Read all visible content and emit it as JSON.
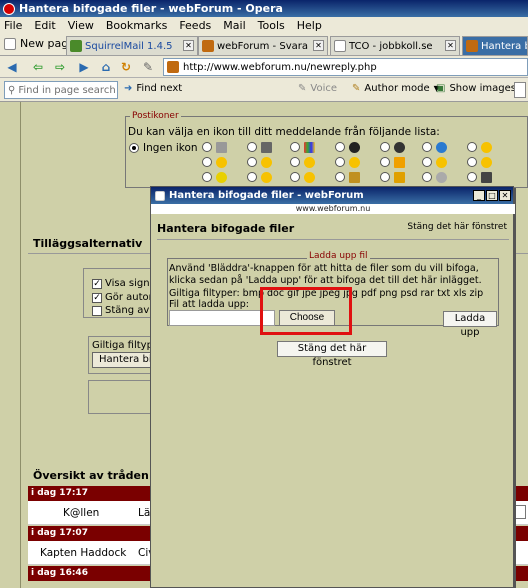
{
  "window": {
    "title": "Hantera bifogade filer - webForum - Opera"
  },
  "menu": [
    "File",
    "Edit",
    "View",
    "Bookmarks",
    "Feeds",
    "Mail",
    "Tools",
    "Help"
  ],
  "tabs": {
    "new_page": "New page",
    "items": [
      {
        "label": "SquirrelMail 1.4.5",
        "active": false
      },
      {
        "label": "webForum - Svara",
        "active": false
      },
      {
        "label": "TCO - jobbkoll.se",
        "active": false
      },
      {
        "label": "Hantera bifo",
        "active": true
      }
    ]
  },
  "address": {
    "url": "http://www.webforum.nu/newreply.php"
  },
  "searchbar": {
    "find_placeholder": "Find in page search",
    "find_next": "Find next",
    "voice": "Voice",
    "author_mode": "Author mode",
    "show_images": "Show images"
  },
  "postikoner": {
    "legend": "Postikoner",
    "text": "Du kan välja en ikon till ditt meddelande från följande lista:",
    "ingen": "Ingen ikon"
  },
  "tillagg": {
    "title": "Tilläggsalternativ",
    "options": [
      {
        "label": "Visa signa",
        "checked": true
      },
      {
        "label": "Gör autom",
        "checked": true
      },
      {
        "label": "Stäng av s",
        "checked": false
      }
    ],
    "giltiga_label": "Giltiga filtyper",
    "hantera_button": "Hantera bifo"
  },
  "oversikt": {
    "title": "Översikt av tråden (s",
    "rows": [
      {
        "day": "i dag 17:17",
        "author": "K@llen",
        "preview": "Lä"
      },
      {
        "day": "i dag 17:07",
        "author": "Kapten Haddock",
        "preview": "Civ"
      },
      {
        "day": "i dag 16:46",
        "author": "",
        "preview": ""
      }
    ]
  },
  "popup": {
    "title": "Hantera bifogade filer - webForum",
    "url": "www.webforum.nu",
    "heading": "Hantera bifogade filer",
    "close_link": "Stäng det här fönstret",
    "upload_legend": "Ladda upp fil",
    "instructions": "Använd 'Bläddra'-knappen för att hitta de filer som du vill bifoga, klicka sedan på 'Ladda upp' för att bifoga det till det här inlägget.",
    "filetypes": "Giltiga filtyper: bmp doc gif jpe jpeg jpg pdf png psd rar txt xls zip",
    "file_label": "Fil att ladda upp:",
    "choose_button": "Choose",
    "upload_button": "Ladda upp",
    "close_button": "Stäng det här fönstret",
    "highlight_color": "#e01010"
  }
}
